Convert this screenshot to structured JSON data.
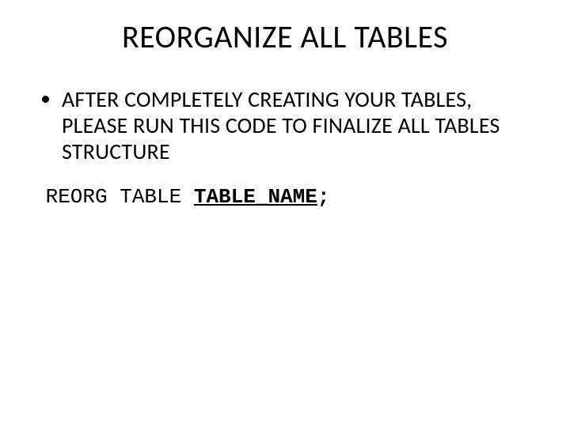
{
  "title": "REORGANIZE ALL TABLES",
  "bullets": [
    "AFTER COMPLETELY CREATING YOUR TABLES, PLEASE RUN THIS CODE TO FINALIZE ALL TABLES STRUCTURE"
  ],
  "code": {
    "prefix": " REORG TABLE ",
    "emph": "TABLE_NAME",
    "suffix": ";"
  }
}
